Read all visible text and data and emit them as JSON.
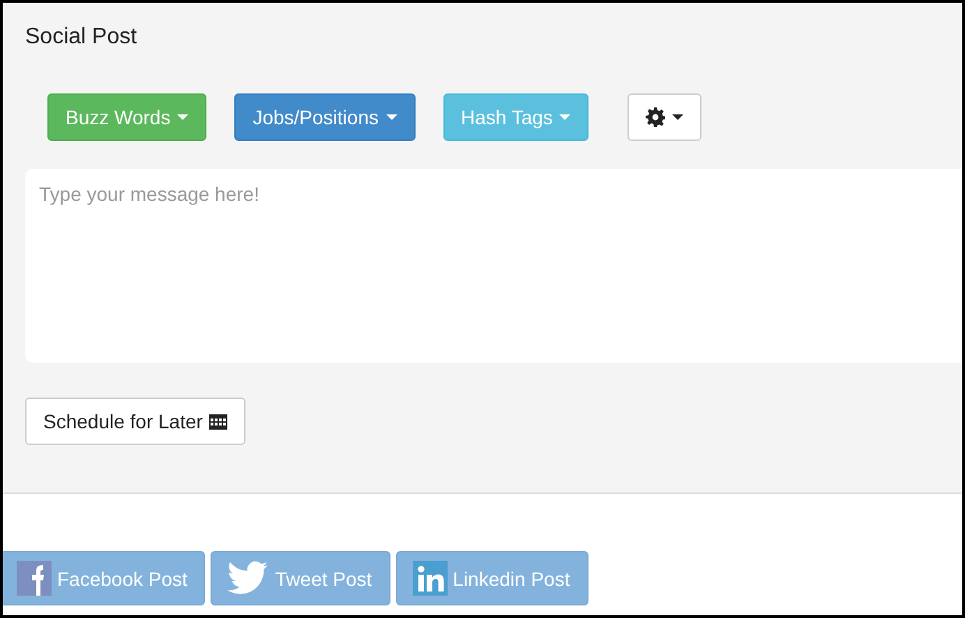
{
  "panel": {
    "title": "Social Post"
  },
  "dropdowns": [
    {
      "label": "Buzz Words",
      "kind": "success"
    },
    {
      "label": "Jobs/Positions",
      "kind": "primary"
    },
    {
      "label": "Hash Tags",
      "kind": "info"
    },
    {
      "kind": "settings"
    }
  ],
  "message": {
    "placeholder": "Type your message here!"
  },
  "schedule_button": {
    "label": "Schedule for Later"
  },
  "post_buttons": [
    {
      "label": "Facebook Post",
      "kind": "facebook"
    },
    {
      "label": "Tweet Post",
      "kind": "twitter"
    },
    {
      "label": "Linkedin Post",
      "kind": "linkedin"
    }
  ]
}
